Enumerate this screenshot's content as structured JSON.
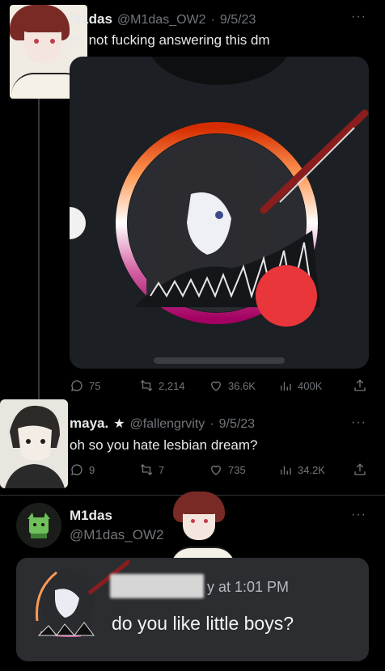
{
  "tweet1": {
    "display_name": "M1das",
    "handle": "@M1das_OW2",
    "date": "9/5/23",
    "text": "Im not fucking answering this dm",
    "actions": {
      "replies": "75",
      "reposts": "2,214",
      "likes": "36.6K",
      "views": "400K"
    }
  },
  "tweet2": {
    "display_name": "maya.",
    "star": "★",
    "handle": "@fallengrvity",
    "date": "9/5/23",
    "text": "oh so you hate lesbian dream?",
    "actions": {
      "replies": "9",
      "reposts": "7",
      "likes": "735",
      "views": "34.2K"
    }
  },
  "tweet3": {
    "display_name": "M1das",
    "handle": "@M1das_OW2"
  },
  "discord_message": {
    "timestamp": "y at 1:01 PM",
    "text": "do you like little boys?"
  },
  "more_glyph": "···",
  "colors": {
    "background": "#000000",
    "muted": "#71767b",
    "media_card": "#1c1f23",
    "discord_bg": "#2b2d31",
    "lesbian_ring": [
      "#d52d00",
      "#ff9a56",
      "#ffffff",
      "#d362a4",
      "#a30262"
    ]
  }
}
